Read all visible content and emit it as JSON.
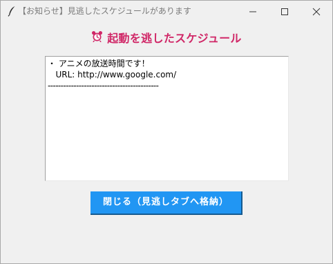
{
  "window": {
    "title": "【お知らせ】見逃したスケジュールがあります"
  },
  "heading": {
    "text": "起動を逃したスケジュール",
    "icon": "alarm-clock-icon",
    "color": "#d02767"
  },
  "message_box": {
    "lines": [
      "・ アニメの放送時間です！",
      "   URL: http://www.google.com/",
      "-------------------------------------------"
    ]
  },
  "close_button": {
    "label": "閉じる（見逃しタブへ格納）",
    "color": "#2196f3"
  }
}
